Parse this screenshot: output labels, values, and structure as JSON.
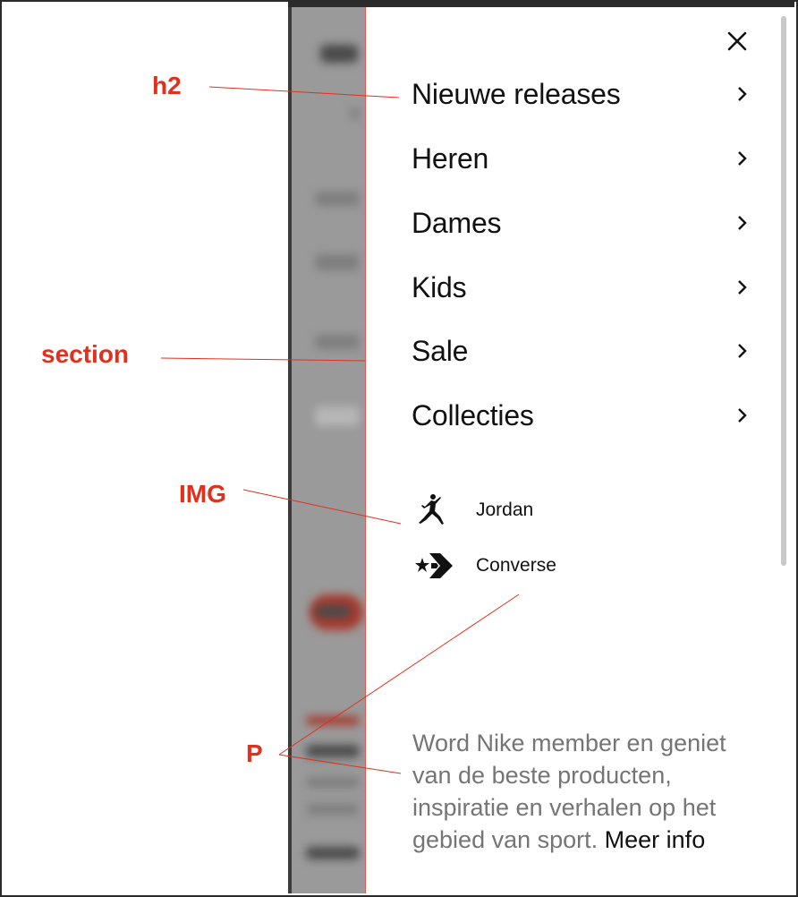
{
  "drawer": {
    "nav": [
      {
        "label": "Nieuwe releases"
      },
      {
        "label": "Heren"
      },
      {
        "label": "Dames"
      },
      {
        "label": "Kids"
      },
      {
        "label": "Sale"
      },
      {
        "label": "Collecties"
      }
    ],
    "brands": [
      {
        "name": "Jordan",
        "icon": "jumpman-icon"
      },
      {
        "name": "Converse",
        "icon": "converse-star-chevron-icon"
      }
    ],
    "member": {
      "text": "Word Nike member en geniet van de beste producten, inspiratie en verhalen op het gebied van sport.",
      "link": "Meer info"
    },
    "close_icon": "close-icon"
  },
  "annotations": {
    "h2": "h2",
    "section": "section",
    "img": "IMG",
    "p": "P"
  },
  "colors": {
    "annotation": "#e0301e",
    "text": "#111111",
    "muted": "#757575"
  }
}
